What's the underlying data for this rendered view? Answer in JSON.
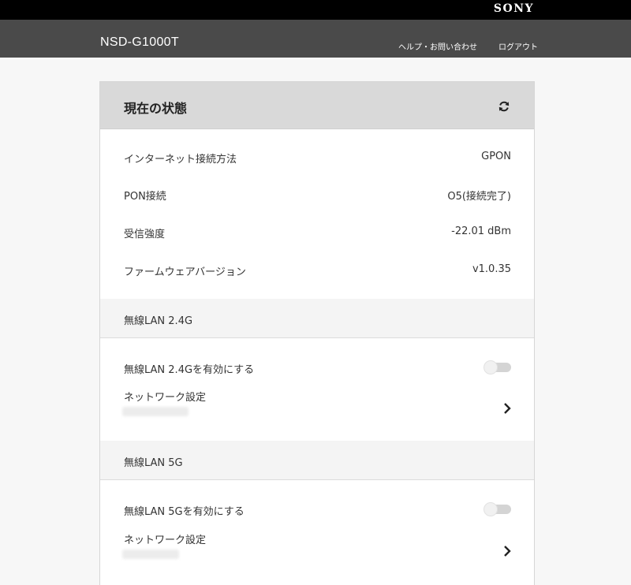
{
  "brand": {
    "logo": "SONY"
  },
  "header": {
    "model": "NSD-G1000T",
    "help_link": "ヘルプ・お問い合わせ",
    "logout_link": "ログアウト"
  },
  "status_panel": {
    "title": "現在の状態",
    "refresh_icon": "refresh-icon",
    "rows": [
      {
        "label": "インターネット接続方法",
        "value": "GPON"
      },
      {
        "label": "PON接続",
        "value": "O5(接続完了)"
      },
      {
        "label": "受信強度",
        "value": "-22.01 dBm"
      },
      {
        "label": "ファームウェアバージョン",
        "value": "v1.0.35"
      }
    ]
  },
  "wlan_24g": {
    "section_title": "無線LAN 2.4G",
    "toggle_label": "無線LAN 2.4Gを有効にする",
    "enabled": false,
    "network_label": "ネットワーク設定",
    "chevron_icon": "chevron-right-icon"
  },
  "wlan_5g": {
    "section_title": "無線LAN 5G",
    "toggle_label": "無線LAN 5Gを有効にする",
    "enabled": false,
    "network_label": "ネットワーク設定",
    "chevron_icon": "chevron-right-icon"
  },
  "colors": {
    "topbar": "#000000",
    "header": "#4a4a4a",
    "panel_head": "#d9d9d9",
    "section_head": "#f4f4f4",
    "page_bg": "#f7f7f7"
  }
}
